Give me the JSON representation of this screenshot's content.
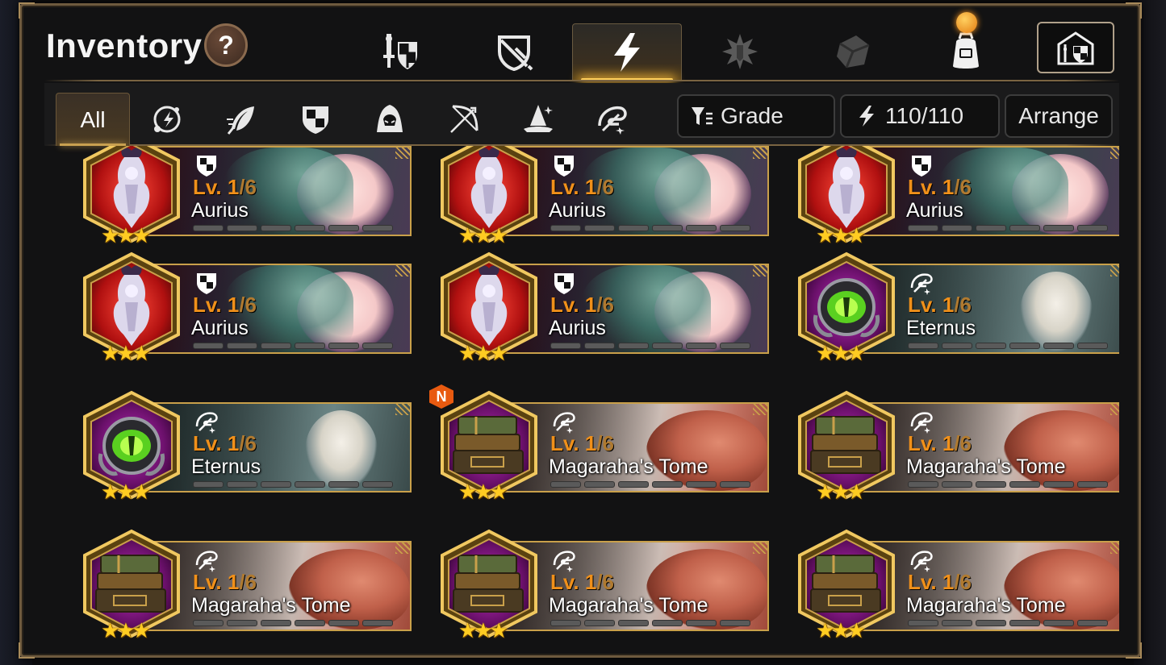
{
  "header": {
    "title": "Inventory",
    "help_label": "?"
  },
  "category_tabs": [
    {
      "name": "weapon-armor",
      "active": false
    },
    {
      "name": "accessory",
      "active": false
    },
    {
      "name": "artifact",
      "active": true
    },
    {
      "name": "material",
      "active": false
    },
    {
      "name": "misc",
      "active": false
    },
    {
      "name": "bag",
      "active": false,
      "notification": true
    }
  ],
  "class_filter": {
    "all_label": "All",
    "items": [
      "all",
      "soul-weaver",
      "mage-feather",
      "knight",
      "assassin",
      "ranger",
      "mage",
      "soul-weaver-2"
    ]
  },
  "controls": {
    "grade_label": "Grade",
    "capacity": "110/110",
    "arrange_label": "Arrange"
  },
  "colors": {
    "accent": "#c9a04a",
    "level": "#f0901a",
    "star": "#ffcc22",
    "new_badge": "#e85a10"
  },
  "items": [
    {
      "name": "Aurius",
      "level": "Lv. 1",
      "max": "/6",
      "stars": "★★★",
      "class_icon": "knight-icon",
      "type": "aurius",
      "new": false,
      "new_label": ""
    },
    {
      "name": "Aurius",
      "level": "Lv. 1",
      "max": "/6",
      "stars": "★★★",
      "class_icon": "knight-icon",
      "type": "aurius",
      "new": false,
      "new_label": ""
    },
    {
      "name": "Aurius",
      "level": "Lv. 1",
      "max": "/6",
      "stars": "★★★",
      "class_icon": "knight-icon",
      "type": "aurius",
      "new": false,
      "new_label": ""
    },
    {
      "name": "Aurius",
      "level": "Lv. 1",
      "max": "/6",
      "stars": "★★★",
      "class_icon": "knight-icon",
      "type": "aurius",
      "new": false,
      "new_label": ""
    },
    {
      "name": "Aurius",
      "level": "Lv. 1",
      "max": "/6",
      "stars": "★★★",
      "class_icon": "knight-icon",
      "type": "aurius",
      "new": false,
      "new_label": ""
    },
    {
      "name": "Eternus",
      "level": "Lv. 1",
      "max": "/6",
      "stars": "★★★",
      "class_icon": "soul-weaver-icon",
      "type": "eternus",
      "new": false,
      "new_label": ""
    },
    {
      "name": "Eternus",
      "level": "Lv. 1",
      "max": "/6",
      "stars": "★★★",
      "class_icon": "soul-weaver-icon",
      "type": "eternus",
      "new": false,
      "new_label": ""
    },
    {
      "name": "Magaraha's Tome",
      "level": "Lv. 1",
      "max": "/6",
      "stars": "★★★",
      "class_icon": "soul-weaver-icon",
      "type": "tome",
      "new": true,
      "new_label": "N"
    },
    {
      "name": "Magaraha's Tome",
      "level": "Lv. 1",
      "max": "/6",
      "stars": "★★★",
      "class_icon": "soul-weaver-icon",
      "type": "tome",
      "new": false,
      "new_label": ""
    },
    {
      "name": "Magaraha's Tome",
      "level": "Lv. 1",
      "max": "/6",
      "stars": "★★★",
      "class_icon": "soul-weaver-icon",
      "type": "tome",
      "new": false,
      "new_label": ""
    },
    {
      "name": "Magaraha's Tome",
      "level": "Lv. 1",
      "max": "/6",
      "stars": "★★★",
      "class_icon": "soul-weaver-icon",
      "type": "tome",
      "new": false,
      "new_label": ""
    },
    {
      "name": "Magaraha's Tome",
      "level": "Lv. 1",
      "max": "/6",
      "stars": "★★★",
      "class_icon": "soul-weaver-icon",
      "type": "tome",
      "new": false,
      "new_label": ""
    }
  ]
}
